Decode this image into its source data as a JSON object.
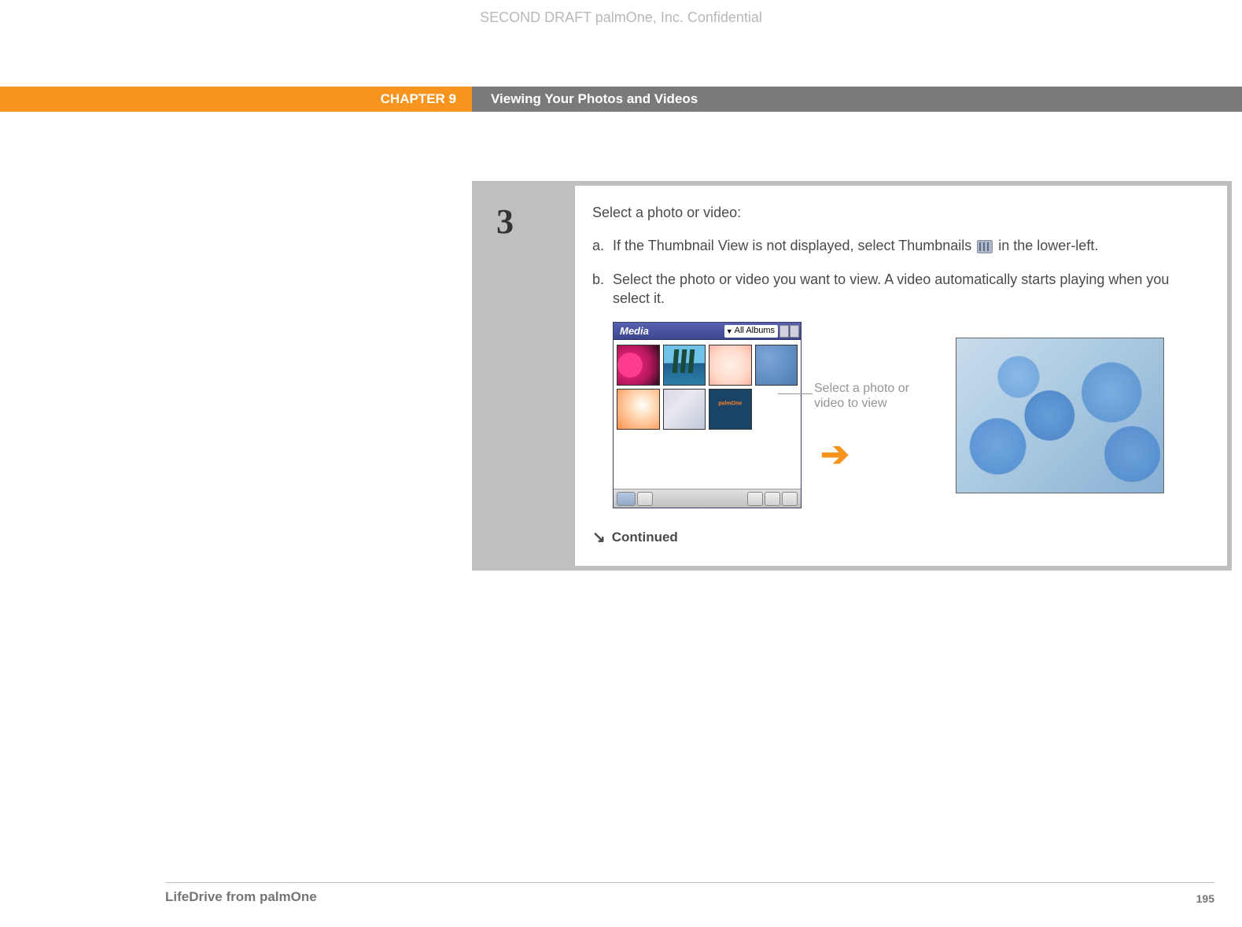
{
  "watermark": "SECOND DRAFT palmOne, Inc.  Confidential",
  "header": {
    "chapter": "CHAPTER 9",
    "title": "Viewing Your Photos and Videos"
  },
  "step": {
    "number": "3",
    "heading": "Select a photo or video:",
    "items": [
      {
        "letter": "a.",
        "text_before": "If the Thumbnail View is not displayed, select Thumbnails ",
        "text_after": " in the lower-left."
      },
      {
        "letter": "b.",
        "text": "Select the photo or video you want to view. A video automatically starts playing when you select it."
      }
    ],
    "media_window": {
      "title": "Media",
      "dropdown": "All Albums"
    },
    "annotation": "Select a photo or video to view",
    "continued": "Continued"
  },
  "footer": {
    "product": "LifeDrive from palmOne",
    "page": "195"
  }
}
